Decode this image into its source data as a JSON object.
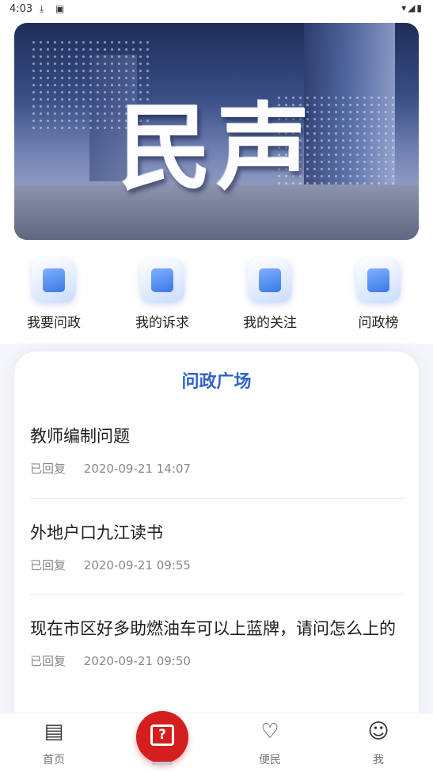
{
  "status": {
    "time": "4:03",
    "battery_icon": "battery-icon"
  },
  "banner": {
    "title": "民声"
  },
  "quick_actions": [
    {
      "label": "我要问政",
      "icon": "ask-government-icon"
    },
    {
      "label": "我的诉求",
      "icon": "my-appeal-icon"
    },
    {
      "label": "我的关注",
      "icon": "my-follow-icon"
    },
    {
      "label": "问政榜",
      "icon": "ranking-icon"
    }
  ],
  "plaza": {
    "title": "问政广场",
    "items": [
      {
        "question": "教师编制问题",
        "status": "已回复",
        "time": "2020-09-21 14:07"
      },
      {
        "question": "外地户口九江读书",
        "status": "已回复",
        "time": "2020-09-21 09:55"
      },
      {
        "question": "现在市区好多助燃油车可以上蓝牌，请问怎么上的",
        "status": "已回复",
        "time": "2020-09-21 09:50"
      }
    ]
  },
  "tabbar": {
    "tabs": [
      {
        "label": "首页",
        "icon": "home-news-icon"
      },
      {
        "label": "",
        "icon": "question-icon"
      },
      {
        "label": "便民",
        "icon": "handshake-heart-icon"
      },
      {
        "label": "我",
        "icon": "profile-icon"
      }
    ]
  },
  "colors": {
    "accent": "#2f63c9",
    "fab": "#d51f1f"
  }
}
